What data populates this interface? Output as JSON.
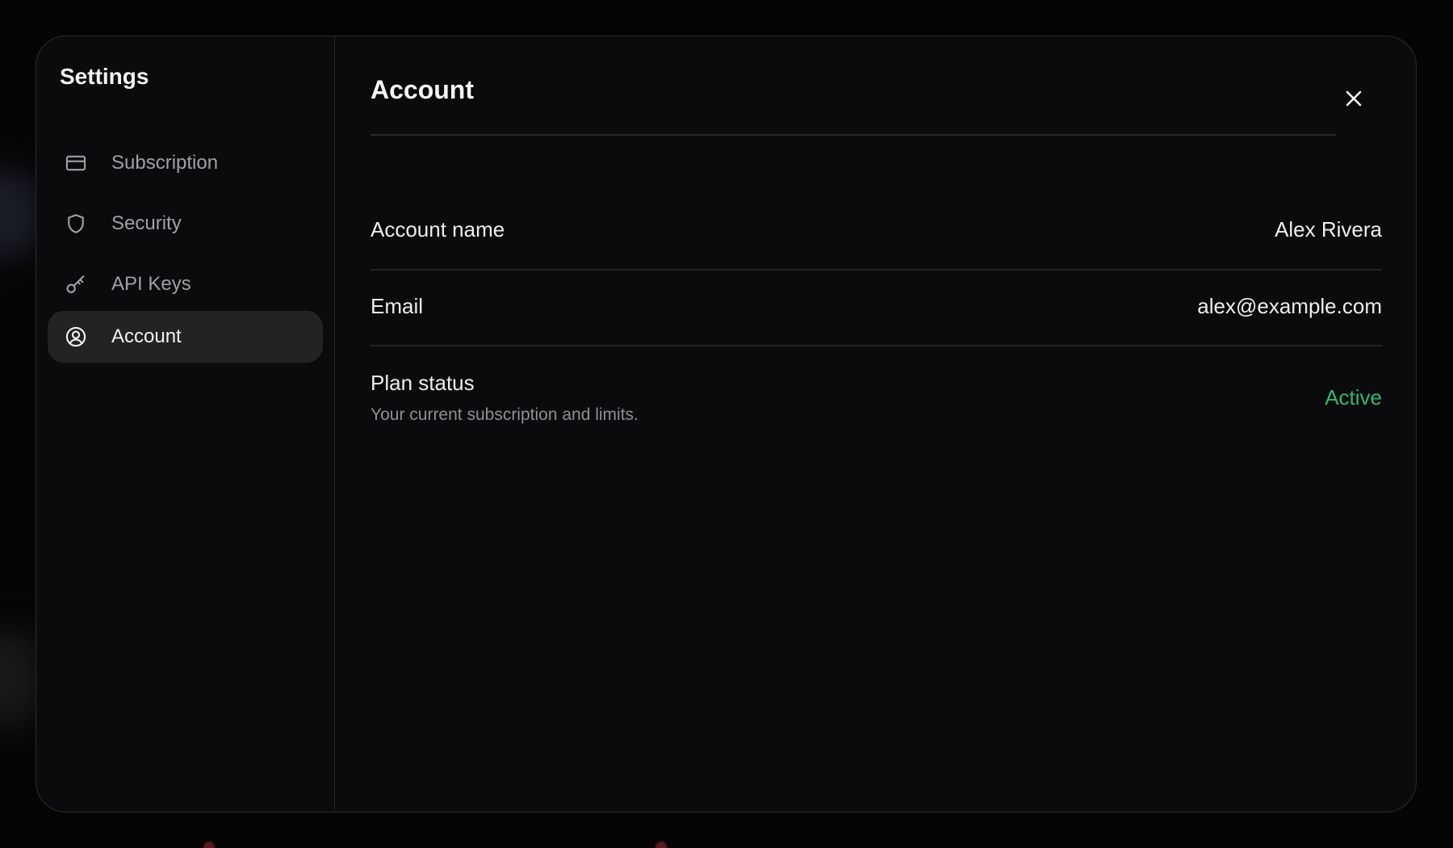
{
  "sidebar": {
    "title": "Settings",
    "items": [
      {
        "label": "Subscription",
        "icon": "credit-card-icon",
        "active": false
      },
      {
        "label": "Security",
        "icon": "shield-icon",
        "active": false
      },
      {
        "label": "API Keys",
        "icon": "key-icon",
        "active": false
      },
      {
        "label": "Account",
        "icon": "user-circle-icon",
        "active": true
      }
    ]
  },
  "main": {
    "title": "Account",
    "close_icon": "close-icon",
    "rows": {
      "account_name": {
        "label": "Account name",
        "value": "Alex Rivera"
      },
      "email": {
        "label": "Email",
        "value": "alex@example.com"
      },
      "plan_status": {
        "label": "Plan status",
        "description": "Your current subscription and limits.",
        "value": "Active",
        "value_color": "#2fb872"
      }
    }
  },
  "colors": {
    "background": "#050506",
    "modal": "#0b0b0d",
    "active_item": "#232326",
    "accent_green": "#2fb872"
  }
}
